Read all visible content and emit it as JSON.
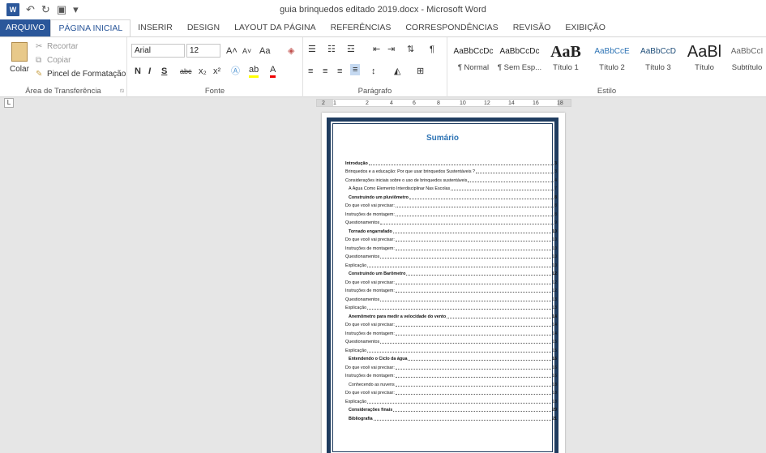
{
  "window": {
    "title": "guia brinquedos editado 2019.docx - Microsoft Word"
  },
  "quick_access": {
    "app_icon": "word-icon",
    "undo_icon": "undo-icon",
    "redo_icon": "redo-icon",
    "save_icon": "save-icon",
    "customize_icon": "customize-icon"
  },
  "tabs": [
    "ARQUIVO",
    "PÁGINA INICIAL",
    "INSERIR",
    "DESIGN",
    "LAYOUT DA PÁGINA",
    "REFERÊNCIAS",
    "CORRESPONDÊNCIAS",
    "REVISÃO",
    "EXIBIÇÃO"
  ],
  "clipboard": {
    "paste": "Colar",
    "cut": "Recortar",
    "copy": "Copiar",
    "format_painter": "Pincel de Formatação",
    "label": "Área de Transferência"
  },
  "font": {
    "name": "Arial",
    "size": "12",
    "grow": "A˄",
    "shrink": "A˅",
    "case": "Aa",
    "bold": "N",
    "italic": "I",
    "underline": "S",
    "strike": "abc",
    "subscript": "x₂",
    "superscript": "x²",
    "label": "Fonte"
  },
  "paragraph": {
    "label": "Parágrafo"
  },
  "styles": {
    "label": "Estilo",
    "items": [
      {
        "preview": "AaBbCcDc",
        "name": "¶ Normal"
      },
      {
        "preview": "AaBbCcDc",
        "name": "¶ Sem Esp..."
      },
      {
        "preview": "AaB",
        "name": "Título 1"
      },
      {
        "preview": "AaBbCcE",
        "name": "Título 2"
      },
      {
        "preview": "AaBbCcD",
        "name": "Título 3"
      },
      {
        "preview": "AaBl",
        "name": "Título"
      },
      {
        "preview": "AaBbCcI",
        "name": "Subtítulo"
      }
    ]
  },
  "ruler": {
    "numbers": [
      "2",
      "1",
      "2",
      "4",
      "6",
      "8",
      "10",
      "12",
      "14",
      "16",
      "18"
    ]
  },
  "document": {
    "toc_title": "Sumário",
    "toc": [
      {
        "text": "Introdução",
        "page": "3",
        "bold": true,
        "indent": false
      },
      {
        "text": "Brinquedos e a educação: Por que usar brinquedos Sustentáveis ?",
        "page": "3",
        "bold": false,
        "indent": false
      },
      {
        "text": "Considerações iniciais  sobre o uso de brinquedos sustentáveis",
        "page": "4",
        "bold": false,
        "indent": false
      },
      {
        "text": "A Água Como Elemento Interdisciplinar Nas Escolas",
        "page": "7",
        "bold": false,
        "indent": true
      },
      {
        "text": "Construindo um pluviômetro",
        "page": "8",
        "bold": true,
        "indent": true
      },
      {
        "text": "Do que você vai precisar:",
        "page": "8",
        "bold": false,
        "indent": false
      },
      {
        "text": "Instruções de montagem:",
        "page": "8",
        "bold": false,
        "indent": false
      },
      {
        "text": "Questionamentos",
        "page": "9",
        "bold": false,
        "indent": false
      },
      {
        "text": "Tornado engarrafado",
        "page": "10",
        "bold": true,
        "indent": true
      },
      {
        "text": "Do que você vai precisar:",
        "page": "10",
        "bold": false,
        "indent": false
      },
      {
        "text": "Instruções de montagem:",
        "page": "10",
        "bold": false,
        "indent": false
      },
      {
        "text": "Questionamentos",
        "page": "10",
        "bold": false,
        "indent": false
      },
      {
        "text": "Explicação",
        "page": "10",
        "bold": false,
        "indent": false
      },
      {
        "text": "Construindo um Barômetro",
        "page": "12",
        "bold": true,
        "indent": true
      },
      {
        "text": "Do que você vai precisar:",
        "page": "12",
        "bold": false,
        "indent": false
      },
      {
        "text": "Instruções de montagem:",
        "page": "12",
        "bold": false,
        "indent": false
      },
      {
        "text": "Questionamentos",
        "page": "13",
        "bold": false,
        "indent": false
      },
      {
        "text": "Explicação",
        "page": "13",
        "bold": false,
        "indent": false
      },
      {
        "text": "Anemômetro para medir a velocidade do vento",
        "page": "14",
        "bold": true,
        "indent": true
      },
      {
        "text": "Do que você vai precisar:",
        "page": "14",
        "bold": false,
        "indent": false
      },
      {
        "text": "Instruções de montagem:",
        "page": "14",
        "bold": false,
        "indent": false
      },
      {
        "text": "Questionamentos",
        "page": "15",
        "bold": false,
        "indent": false
      },
      {
        "text": "Explicação",
        "page": "15",
        "bold": false,
        "indent": false
      },
      {
        "text": "Entendendo o Ciclo da água",
        "page": "16",
        "bold": true,
        "indent": true
      },
      {
        "text": "Do que você vai precisar:",
        "page": "16",
        "bold": false,
        "indent": false
      },
      {
        "text": "Instruções de montagem:",
        "page": "16",
        "bold": false,
        "indent": false
      },
      {
        "text": "Conhecendo as nuvens",
        "page": "18",
        "bold": false,
        "indent": true
      },
      {
        "text": "Do que você vai precisar:",
        "page": "18",
        "bold": false,
        "indent": false
      },
      {
        "text": "Explicação",
        "page": "18",
        "bold": false,
        "indent": false
      },
      {
        "text": "Considerações finais",
        "page": "20",
        "bold": true,
        "indent": true
      },
      {
        "text": "Bibliografia",
        "page": "21",
        "bold": true,
        "indent": true
      }
    ]
  },
  "colors": {
    "accent": "#2b579a",
    "frame": "#1f3c5f",
    "toc_title": "#2e74b5"
  }
}
